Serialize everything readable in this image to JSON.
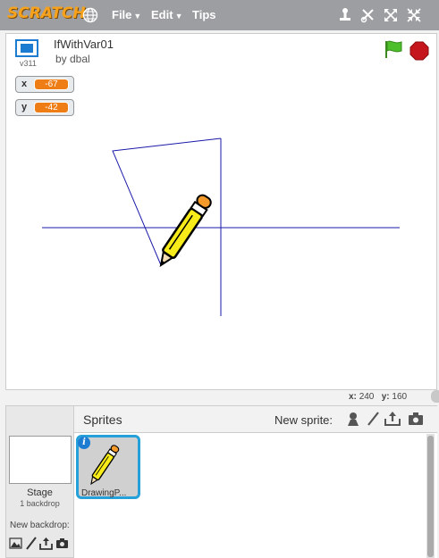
{
  "topbar": {
    "logo_text": "SCRATCH",
    "menu": [
      {
        "label": "File",
        "has_arrow": true
      },
      {
        "label": "Edit",
        "has_arrow": true
      },
      {
        "label": "Tips",
        "has_arrow": false
      }
    ],
    "tools": [
      "duplicate-icon",
      "cut-icon",
      "grow-icon",
      "shrink-icon"
    ]
  },
  "project": {
    "version": "v311",
    "title": "IfWithVar01",
    "author": "by dbal"
  },
  "monitors": [
    {
      "label": "x",
      "value": "-67"
    },
    {
      "label": "y",
      "value": "-42"
    }
  ],
  "stage_info": {
    "x_label": "x:",
    "x_value": "240",
    "y_label": "y:",
    "y_value": "160"
  },
  "stage_panel": {
    "label": "Stage",
    "backdrop_count": "1 backdrop",
    "new_backdrop": "New backdrop:"
  },
  "sprites": {
    "title": "Sprites",
    "new_sprite": "New sprite:",
    "items": [
      {
        "name": "DrawingP..."
      }
    ]
  },
  "colors": {
    "topbar": "#9c9ea2",
    "logo": "#f7a21c",
    "monitor_value": "#ee7d16",
    "pen_line": "#1a1aa8",
    "selection": "#25a0d9",
    "flag": "#4cbf2a",
    "stop": "#c4161c"
  }
}
